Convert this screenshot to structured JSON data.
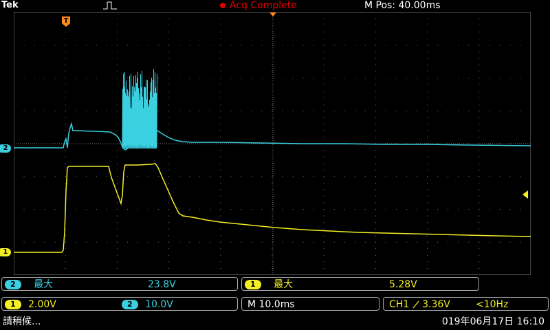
{
  "header": {
    "brand": "Tek",
    "acq_status": "Acq Complete",
    "m_pos": "M Pos: 40.00ms"
  },
  "markers": {
    "ch2": "2",
    "ch1": "1",
    "trigger": "T"
  },
  "measurements": [
    {
      "channel": "2",
      "label": "最大",
      "value": "23.8V"
    },
    {
      "channel": "1",
      "label": "最大",
      "value": "5.28V"
    }
  ],
  "channel_settings": {
    "ch1": {
      "channel": "1",
      "scale": "2.00V"
    },
    "ch2": {
      "channel": "2",
      "scale": "10.0V"
    }
  },
  "timebase": "M 10.0ms",
  "trigger": {
    "source": "CH1",
    "slope_icon": "rising-edge-icon",
    "level": "3.36V",
    "freq": "<10Hz"
  },
  "status": {
    "message": "請稍候...",
    "datetime": "019年06月17日 16:10"
  },
  "colors": {
    "ch1": "#f4ef25",
    "ch2": "#3ad0e0",
    "acq": "#e00000",
    "trigger_marker": "#ff8c1a"
  }
}
